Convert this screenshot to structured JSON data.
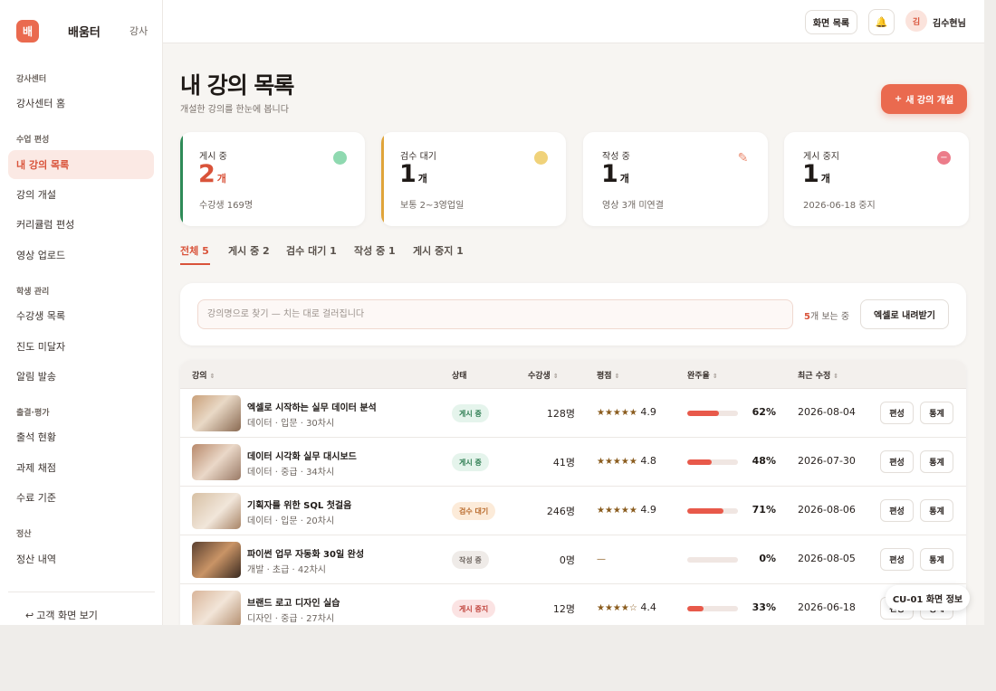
{
  "brand": {
    "logo_char": "배",
    "name": "배움터",
    "role": "강사"
  },
  "sidebar": {
    "groups": [
      {
        "label": "강사센터"
      },
      {
        "label": "수업 편성"
      },
      {
        "label": "학생 관리"
      },
      {
        "label": "출결·평가"
      },
      {
        "label": "정산"
      }
    ],
    "items": [
      {
        "label": "강사센터 홈",
        "active": false
      },
      {
        "label": "내 강의 목록",
        "active": true
      },
      {
        "label": "강의 개설",
        "active": false
      },
      {
        "label": "커리큘럼 편성",
        "active": false
      },
      {
        "label": "영상 업로드",
        "active": false
      },
      {
        "label": "수강생 목록",
        "active": false
      },
      {
        "label": "진도 미달자",
        "active": false
      },
      {
        "label": "알림 발송",
        "active": false
      },
      {
        "label": "출석 현황",
        "active": false
      },
      {
        "label": "과제 채점",
        "active": false
      },
      {
        "label": "수료 기준",
        "active": false
      },
      {
        "label": "정산 내역",
        "active": false
      }
    ],
    "back_link": "고객 화면 보기",
    "back_icon": "return-arrow-icon"
  },
  "topbar": {
    "screen_list_label": "화면 목록",
    "bell_icon": "bell-icon",
    "avatar_char": "김",
    "user_name": "김수현님"
  },
  "page": {
    "title": "내 강의 목록",
    "subtitle": "개설한 강의를 한눈에 봅니다",
    "new_button": "새 강의 개설"
  },
  "stats": [
    {
      "label": "게시 중",
      "value": "2",
      "unit": "개",
      "note": "수강생 169명",
      "accent": "#2e8b57",
      "value_color": "#d9533a",
      "icon_color": "#8fd9b0"
    },
    {
      "label": "검수 대기",
      "value": "1",
      "unit": "개",
      "note": "보통 2~3영업일",
      "accent": "#e0a43a",
      "value_color": "#1f1a17",
      "icon_color": "#f0d27a"
    },
    {
      "label": "작성 중",
      "value": "1",
      "unit": "개",
      "note": "영상 3개 미연결",
      "accent": "#ffffff",
      "value_color": "#1f1a17",
      "icon_color": "#ea8a6f"
    },
    {
      "label": "게시 중지",
      "value": "1",
      "unit": "개",
      "note": "2026-06-18 중지",
      "accent": "#ffffff",
      "value_color": "#1f1a17",
      "icon_color": "#ec7c8a"
    }
  ],
  "tabs": [
    {
      "label": "전체",
      "count": "5",
      "active": true
    },
    {
      "label": "게시 중",
      "count": "2",
      "active": false
    },
    {
      "label": "검수 대기",
      "count": "1",
      "active": false
    },
    {
      "label": "작성 중",
      "count": "1",
      "active": false
    },
    {
      "label": "게시 중지",
      "count": "1",
      "active": false
    }
  ],
  "search": {
    "placeholder": "강의명으로 찾기 — 치는 대로 걸러집니다",
    "count_num": "5",
    "count_suffix": "개 보는 중",
    "export_label": "엑셀로 내려받기"
  },
  "table": {
    "columns": [
      "강의",
      "상태",
      "수강생",
      "평점",
      "완주율",
      "최근 수정"
    ],
    "rows": [
      {
        "title": "엑셀로 시작하는 실무 데이터 분석",
        "meta": "데이터 · 입문 · 30차시",
        "status": "게시 중",
        "students": "128명",
        "stars": "★★★★★",
        "rating": "4.9",
        "completion": 62,
        "pct": "62%",
        "date": "2026-08-04"
      },
      {
        "title": "데이터 시각화 실무 대시보드",
        "meta": "데이터 · 중급 · 34차시",
        "status": "게시 중",
        "students": "41명",
        "stars": "★★★★★",
        "rating": "4.8",
        "completion": 48,
        "pct": "48%",
        "date": "2026-07-30"
      },
      {
        "title": "기획자를 위한 SQL 첫걸음",
        "meta": "데이터 · 입문 · 20차시",
        "status": "검수 대기",
        "students": "246명",
        "stars": "★★★★★",
        "rating": "4.9",
        "completion": 71,
        "pct": "71%",
        "date": "2026-08-06"
      },
      {
        "title": "파이썬 업무 자동화 30일 완성",
        "meta": "개발 · 초급 · 42차시",
        "status": "작성 중",
        "students": "0명",
        "stars": "—",
        "rating": "",
        "completion": 0,
        "pct": "0%",
        "date": "2026-08-05"
      },
      {
        "title": "브랜드 로고 디자인 실습",
        "meta": "디자인 · 중급 · 27차시",
        "status": "게시 중지",
        "students": "12명",
        "stars": "★★★★☆",
        "rating": "4.4",
        "completion": 33,
        "pct": "33%",
        "date": "2026-06-18"
      }
    ],
    "edit_label": "편성",
    "stats_label": "통계"
  },
  "status_styles": {
    "게시 중": {
      "bg": "#e5f4ec",
      "fg": "#2e7d52"
    },
    "검수 대기": {
      "bg": "#fcebd9",
      "fg": "#b8692a"
    },
    "작성 중": {
      "bg": "#efebe8",
      "fg": "#6e6660"
    },
    "게시 중지": {
      "bg": "#fbe3e3",
      "fg": "#c0443c"
    }
  },
  "toast": "CU-01 화면 정보"
}
